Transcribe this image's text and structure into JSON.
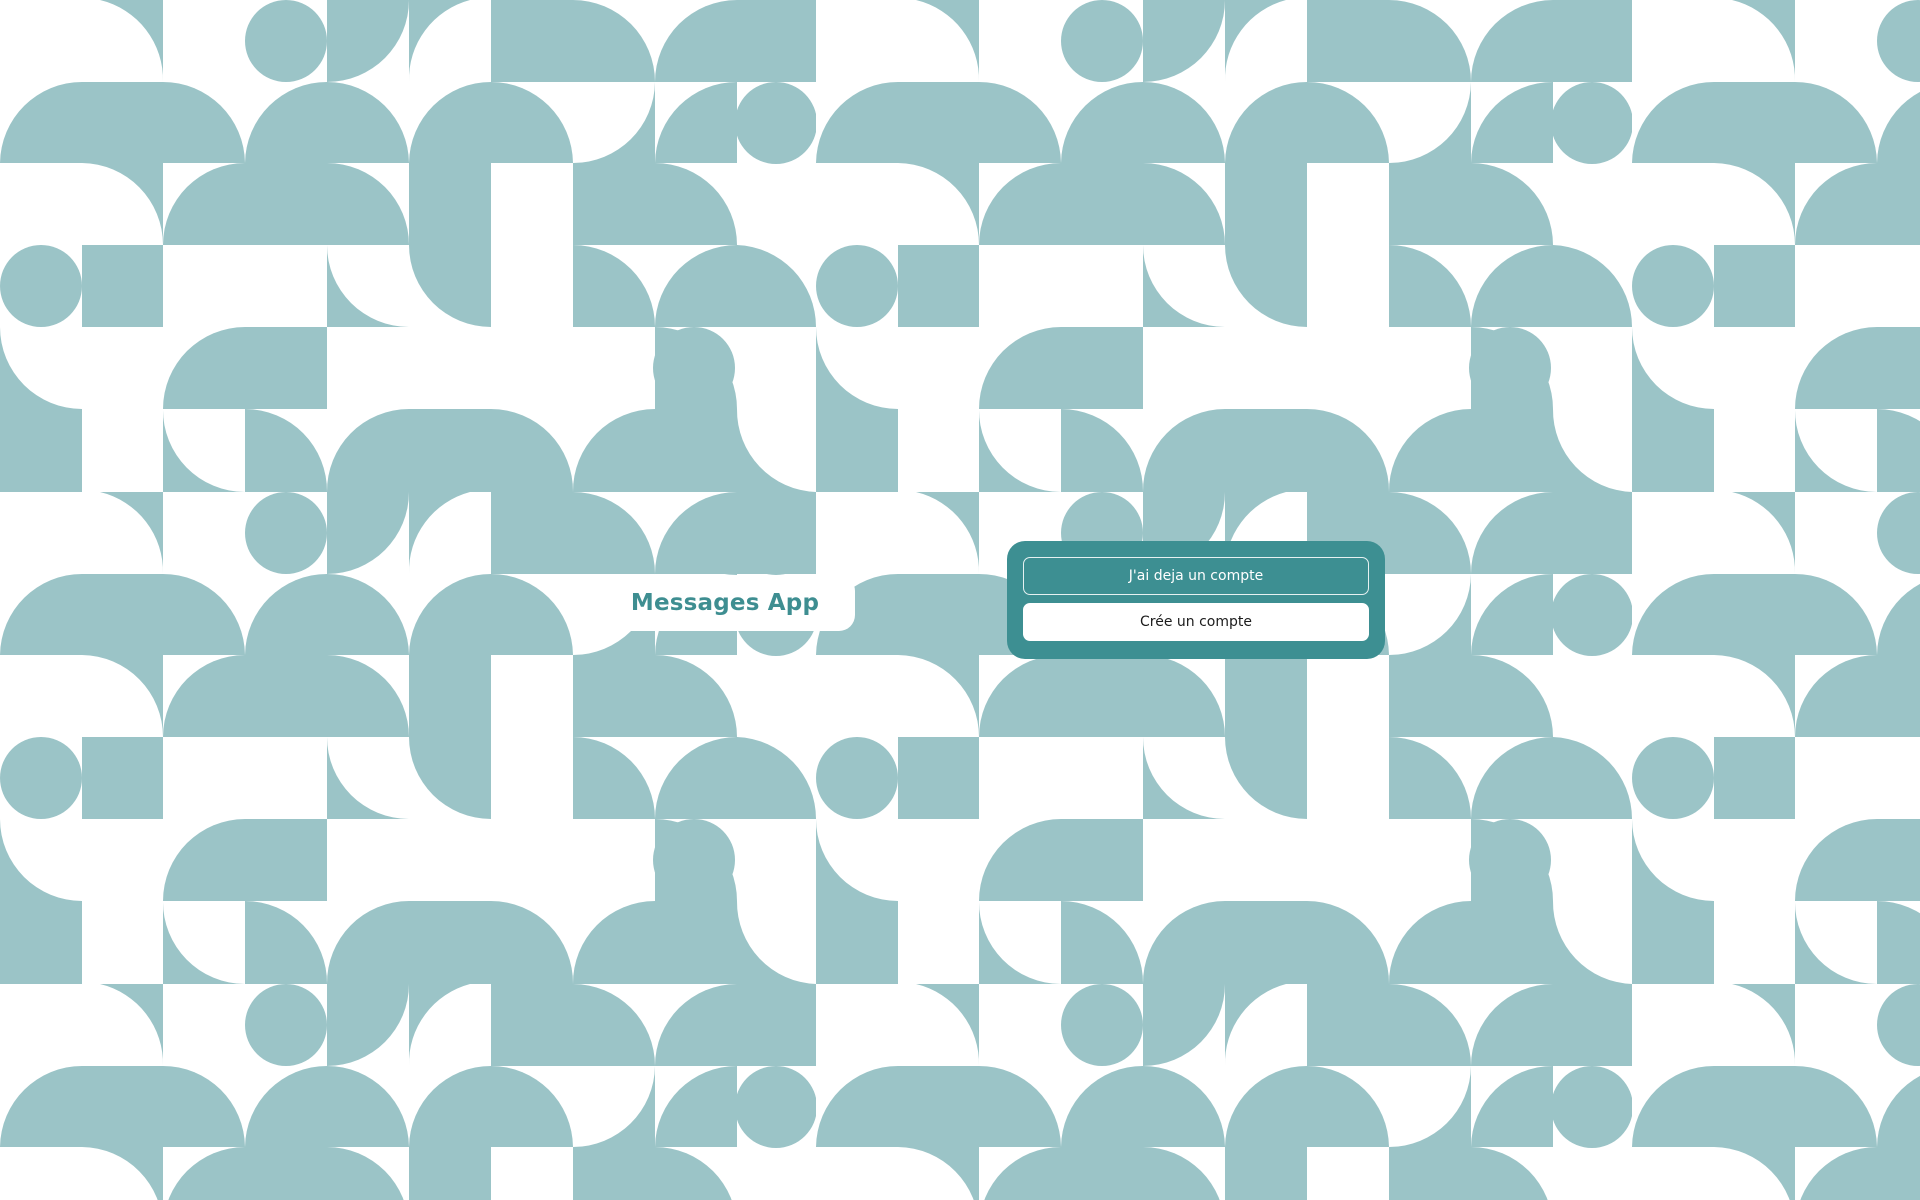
{
  "app": {
    "title": "Messages App"
  },
  "auth": {
    "login_label": "J'ai deja un compte",
    "signup_label": "Crée un compte"
  },
  "colors": {
    "pattern": "#9bc4c7",
    "accent": "#3d8f92",
    "title_text": "#3e8e91",
    "background": "#ffffff"
  }
}
